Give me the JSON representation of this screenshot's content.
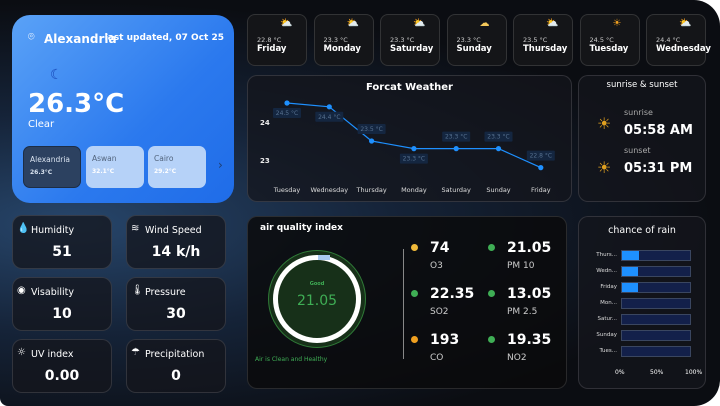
{
  "hero": {
    "city": "Alexandria",
    "last_updated": "last updated, 07 Oct 25",
    "temperature": "26.3°C",
    "condition": "Clear",
    "icon": "moon-icon",
    "cities": [
      {
        "name": "Alexandria",
        "temp": "26.3°C",
        "selected": true
      },
      {
        "name": "Aswan",
        "temp": "32.1°C"
      },
      {
        "name": "Cairo",
        "temp": "29.2°C"
      }
    ]
  },
  "forecast_days": [
    {
      "temp": "22.8 °C",
      "day": "Friday",
      "icon": "rain-cloud-sun"
    },
    {
      "temp": "23.3 °C",
      "day": "Monday",
      "icon": "partly-cloudy"
    },
    {
      "temp": "23.3 °C",
      "day": "Saturday",
      "icon": "partly-cloudy"
    },
    {
      "temp": "23.3 °C",
      "day": "Sunday",
      "icon": "cloud"
    },
    {
      "temp": "23.5 °C",
      "day": "Thursday",
      "icon": "rain-cloud-sun"
    },
    {
      "temp": "24.5 °C",
      "day": "Tuesday",
      "icon": "sun"
    },
    {
      "temp": "24.4 °C",
      "day": "Wednesday",
      "icon": "rain-cloud-sun"
    }
  ],
  "stats": [
    {
      "label": "Humidity",
      "value": "51",
      "icon": "droplet-icon"
    },
    {
      "label": "Wind Speed",
      "value": "14 k/h",
      "icon": "wind-icon"
    },
    {
      "label": "Visability",
      "value": "10",
      "icon": "eye-icon"
    },
    {
      "label": "Pressure",
      "value": "30",
      "icon": "thermometer-icon"
    },
    {
      "label": "UV index",
      "value": "0.00",
      "icon": "uv-icon"
    },
    {
      "label": "Precipitation",
      "value": "0",
      "icon": "rain-cloud-icon"
    }
  ],
  "chart_data": [
    {
      "type": "line",
      "title": "Forcat Weather",
      "categories": [
        "Tuesday",
        "Wednesday",
        "Thursday",
        "Monday",
        "Saturday",
        "Sunday",
        "Friday"
      ],
      "values": [
        24.5,
        24.4,
        23.5,
        23.3,
        23.3,
        23.3,
        22.8
      ],
      "data_labels": [
        "24.5 °C",
        "24.4 °C",
        "23.5 °C",
        "23.3 °C",
        "23.3 °C",
        "23.3 °C",
        "22.8 °C"
      ],
      "yticks": [
        "24",
        "23"
      ],
      "color": "#1e90ff"
    },
    {
      "type": "bar",
      "title": "chance of rain",
      "categories": [
        "Thurs...",
        "Wedn...",
        "Friday",
        "Mon...",
        "Satur...",
        "Sunday",
        "Tues..."
      ],
      "values": [
        25,
        24,
        24,
        0,
        0,
        0,
        0
      ],
      "xticks": [
        "0%",
        "50%",
        "100%"
      ],
      "xlim": [
        0,
        100
      ],
      "color": "#1e90ff"
    }
  ],
  "sun": {
    "title": "sunrise & sunset",
    "sunrise_label": "sunrise",
    "sunrise": "05:58 AM",
    "sunset_label": "sunset",
    "sunset": "05:31 PM"
  },
  "aqi": {
    "title": "air quality index",
    "status": "Good",
    "value": "21.05",
    "message": "Air is Clean and Healthy",
    "items": [
      {
        "value": "74",
        "name": "O3",
        "color": "#f0b93a"
      },
      {
        "value": "21.05",
        "name": "PM 10",
        "color": "#3fae55"
      },
      {
        "value": "22.35",
        "name": "SO2",
        "color": "#3fae55"
      },
      {
        "value": "13.05",
        "name": "PM 2.5",
        "color": "#3fae55"
      },
      {
        "value": "193",
        "name": "CO",
        "color": "#f0a020"
      },
      {
        "value": "19.35",
        "name": "NO2",
        "color": "#3fae55"
      }
    ]
  }
}
